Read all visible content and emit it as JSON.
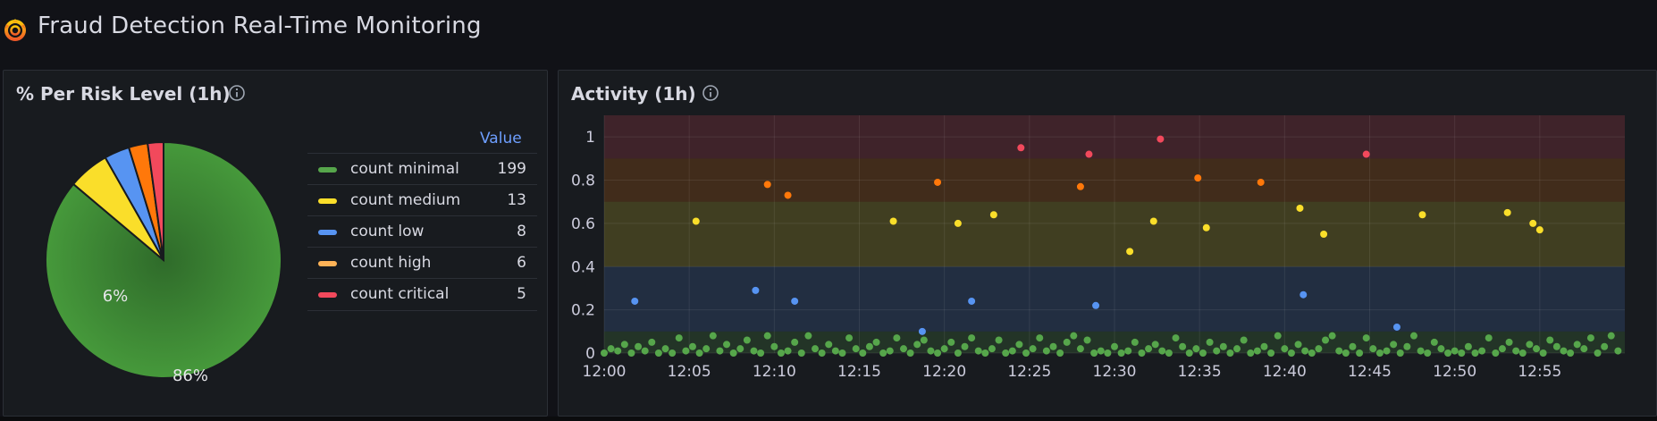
{
  "dashboard": {
    "title": "Fraud Detection Real-Time Monitoring",
    "logo": "grafana-logo-icon"
  },
  "colors": {
    "minimal": "#56a64b",
    "medium": "#fade2a",
    "low": "#5794f2",
    "high": "#ff780a",
    "critical": "#f2495c",
    "accent": "#6e9fff"
  },
  "pie_panel": {
    "title": "% Per Risk Level (1h)",
    "info_icon": "info-circle-icon",
    "legend_header": "Value",
    "legend": [
      {
        "label": "count minimal",
        "value": "199"
      },
      {
        "label": "count medium",
        "value": "13"
      },
      {
        "label": "count low",
        "value": "8"
      },
      {
        "label": "count high",
        "value": "6"
      },
      {
        "label": "count critical",
        "value": "5"
      }
    ],
    "slice_labels": [
      "86%",
      "6%"
    ]
  },
  "activity_panel": {
    "title": "Activity (1h)",
    "info_icon": "info-circle-icon"
  },
  "chart_data": [
    {
      "type": "pie",
      "title": "% Per Risk Level (1h)",
      "categories": [
        "count minimal",
        "count medium",
        "count low",
        "count high",
        "count critical"
      ],
      "values": [
        199,
        13,
        8,
        6,
        5
      ],
      "labels_shown": [
        "86%",
        "6%"
      ],
      "legend": "right"
    },
    {
      "type": "scatter",
      "title": "Activity (1h)",
      "xlabel": "",
      "ylabel": "",
      "x_ticks": [
        "12:00",
        "12:05",
        "12:10",
        "12:15",
        "12:20",
        "12:25",
        "12:30",
        "12:35",
        "12:40",
        "12:45",
        "12:50",
        "12:55"
      ],
      "y_ticks": [
        "0",
        "0.2",
        "0.4",
        "0.6",
        "0.8",
        "1"
      ],
      "xlim": [
        0,
        60
      ],
      "ylim": [
        0,
        1.1
      ],
      "grid": true,
      "threshold_bands": [
        {
          "from": 0,
          "to": 0.1,
          "color": "#56a64b"
        },
        {
          "from": 0.1,
          "to": 0.4,
          "color": "#5794f2"
        },
        {
          "from": 0.4,
          "to": 0.7,
          "color": "#fade2a"
        },
        {
          "from": 0.7,
          "to": 0.9,
          "color": "#ff780a"
        },
        {
          "from": 0.9,
          "to": 1.1,
          "color": "#f2495c"
        }
      ],
      "series": [
        {
          "level": "critical",
          "color": "#f2495c",
          "x": [
            24.5,
            28.5,
            32.7,
            44.8
          ],
          "y": [
            0.95,
            0.92,
            0.99,
            0.92
          ]
        },
        {
          "level": "high",
          "color": "#ff780a",
          "x": [
            9.6,
            10.8,
            19.6,
            28.0,
            34.9,
            38.6
          ],
          "y": [
            0.78,
            0.73,
            0.79,
            0.77,
            0.81,
            0.79
          ]
        },
        {
          "level": "medium",
          "color": "#fade2a",
          "x": [
            5.4,
            17.0,
            20.8,
            22.9,
            30.9,
            32.3,
            35.4,
            40.9,
            42.3,
            48.1,
            53.1,
            54.6,
            55.0
          ],
          "y": [
            0.61,
            0.61,
            0.6,
            0.64,
            0.47,
            0.61,
            0.58,
            0.67,
            0.55,
            0.64,
            0.65,
            0.6,
            0.57
          ]
        },
        {
          "level": "low",
          "color": "#5794f2",
          "x": [
            1.8,
            8.9,
            11.2,
            18.7,
            21.6,
            28.9,
            41.1,
            46.6
          ],
          "y": [
            0.24,
            0.29,
            0.24,
            0.1,
            0.24,
            0.22,
            0.27,
            0.12
          ]
        },
        {
          "level": "minimal",
          "color": "#56a64b",
          "x": [
            0.0,
            0.4,
            0.8,
            1.2,
            1.6,
            2.0,
            2.4,
            2.8,
            3.2,
            3.6,
            4.0,
            4.4,
            4.8,
            5.2,
            5.6,
            6.0,
            6.4,
            6.8,
            7.2,
            7.6,
            8.0,
            8.4,
            8.8,
            9.2,
            9.6,
            10.0,
            10.4,
            10.8,
            11.2,
            11.6,
            12.0,
            12.4,
            12.8,
            13.2,
            13.6,
            14.0,
            14.4,
            14.8,
            15.2,
            15.6,
            16.0,
            16.4,
            16.8,
            17.2,
            17.6,
            18.0,
            18.4,
            18.8,
            19.2,
            19.6,
            20.0,
            20.4,
            20.8,
            21.2,
            21.6,
            22.0,
            22.4,
            22.8,
            23.2,
            23.6,
            24.0,
            24.4,
            24.8,
            25.2,
            25.6,
            26.0,
            26.4,
            26.8,
            27.2,
            27.6,
            28.0,
            28.4,
            28.8,
            29.2,
            29.6,
            30.0,
            30.4,
            30.8,
            31.2,
            31.6,
            32.0,
            32.4,
            32.8,
            33.2,
            33.6,
            34.0,
            34.4,
            34.8,
            35.2,
            35.6,
            36.0,
            36.4,
            36.8,
            37.2,
            37.6,
            38.0,
            38.4,
            38.8,
            39.2,
            39.6,
            40.0,
            40.4,
            40.8,
            41.2,
            41.6,
            42.0,
            42.4,
            42.8,
            43.2,
            43.6,
            44.0,
            44.4,
            44.8,
            45.2,
            45.6,
            46.0,
            46.4,
            46.8,
            47.2,
            47.6,
            48.0,
            48.4,
            48.8,
            49.2,
            49.6,
            50.0,
            50.4,
            50.8,
            51.2,
            51.6,
            52.0,
            52.4,
            52.8,
            53.2,
            53.6,
            54.0,
            54.4,
            54.8,
            55.2,
            55.6,
            56.0,
            56.4,
            56.8,
            57.2,
            57.6,
            58.0,
            58.4,
            58.8,
            59.2,
            59.6
          ],
          "y": [
            0.0,
            0.02,
            0.01,
            0.04,
            0.0,
            0.03,
            0.01,
            0.05,
            0.0,
            0.02,
            0.0,
            0.07,
            0.01,
            0.03,
            0.0,
            0.02,
            0.08,
            0.01,
            0.04,
            0.0,
            0.02,
            0.06,
            0.01,
            0.0,
            0.08,
            0.03,
            0.0,
            0.01,
            0.05,
            0.0,
            0.08,
            0.02,
            0.0,
            0.04,
            0.01,
            0.0,
            0.07,
            0.02,
            0.0,
            0.03,
            0.05,
            0.0,
            0.01,
            0.07,
            0.02,
            0.0,
            0.04,
            0.06,
            0.01,
            0.0,
            0.02,
            0.05,
            0.0,
            0.03,
            0.07,
            0.01,
            0.0,
            0.02,
            0.06,
            0.0,
            0.01,
            0.04,
            0.0,
            0.02,
            0.07,
            0.01,
            0.03,
            0.0,
            0.05,
            0.08,
            0.02,
            0.06,
            0.0,
            0.01,
            0.0,
            0.03,
            0.0,
            0.01,
            0.05,
            0.0,
            0.02,
            0.04,
            0.01,
            0.0,
            0.07,
            0.03,
            0.0,
            0.02,
            0.0,
            0.05,
            0.01,
            0.03,
            0.0,
            0.02,
            0.06,
            0.0,
            0.01,
            0.03,
            0.0,
            0.08,
            0.02,
            0.0,
            0.04,
            0.01,
            0.0,
            0.02,
            0.06,
            0.08,
            0.01,
            0.0,
            0.03,
            0.0,
            0.07,
            0.02,
            0.0,
            0.01,
            0.04,
            0.0,
            0.03,
            0.08,
            0.01,
            0.0,
            0.05,
            0.02,
            0.0,
            0.01,
            0.0,
            0.03,
            0.0,
            0.01,
            0.07,
            0.0,
            0.02,
            0.05,
            0.01,
            0.0,
            0.04,
            0.02,
            0.0,
            0.06,
            0.03,
            0.01,
            0.0,
            0.04,
            0.02,
            0.07,
            0.0,
            0.03,
            0.08,
            0.01
          ]
        }
      ]
    }
  ]
}
